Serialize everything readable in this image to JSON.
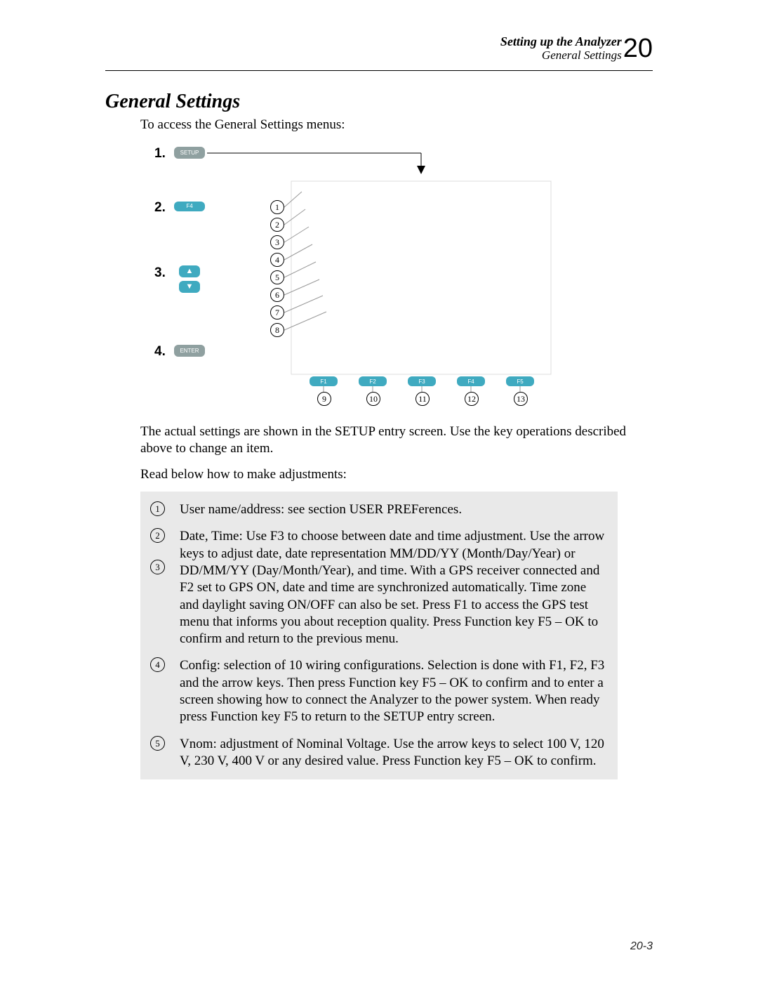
{
  "header": {
    "chapter_title": "Setting up the Analyzer",
    "section_title": "General Settings",
    "chapter_number": "20"
  },
  "section_heading": "General Settings",
  "intro_text": "To access the General Settings menus:",
  "diagram": {
    "steps": {
      "s1": "1.",
      "s2": "2.",
      "s3": "3.",
      "s4": "4."
    },
    "keys": {
      "setup": "SETUP",
      "f4": "F4",
      "up": "▲",
      "down": "▼",
      "enter": "ENTER",
      "f1": "F1",
      "f2": "F2",
      "f3": "F3",
      "f4b": "F4",
      "f5": "F5"
    },
    "circles": {
      "c1": "1",
      "c2": "2",
      "c3": "3",
      "c4": "4",
      "c5": "5",
      "c6": "6",
      "c7": "7",
      "c8": "8",
      "c9": "9",
      "c10": "10",
      "c11": "11",
      "c12": "12",
      "c13": "13"
    }
  },
  "body": {
    "p1": "The actual settings are shown in the SETUP entry screen. Use the key operations described above to change an item.",
    "p2": "Read below how to make adjustments:"
  },
  "callouts": [
    {
      "nums": [
        "1"
      ],
      "text": "User name/address: see section USER PREFerences."
    },
    {
      "nums": [
        "2",
        "3"
      ],
      "text": "Date, Time: Use F3 to choose between date and time adjustment. Use the arrow keys to adjust date, date representation MM/DD/YY (Month/Day/Year) or DD/MM/YY  (Day/Month/Year), and time. With a GPS receiver connected and F2 set to GPS ON, date and time are synchronized automatically. Time zone and daylight saving ON/OFF can also be set. Press F1 to access the GPS test menu that informs you about reception quality. Press Function key F5 – OK to confirm and return to the previous menu."
    },
    {
      "nums": [
        "4"
      ],
      "text": "Config: selection of 10 wiring configurations. Selection is done with F1, F2, F3 and the arrow keys. Then press Function key F5 – OK to confirm and to enter a screen showing how to connect the Analyzer to the power system. When ready press Function key F5 to return to the SETUP entry screen."
    },
    {
      "nums": [
        "5"
      ],
      "text": "Vnom: adjustment of Nominal Voltage. Use the arrow keys to select 100 V, 120 V, 230 V, 400 V or any desired value. Press Function key F5 – OK to confirm."
    }
  ],
  "page_number": "20-3"
}
